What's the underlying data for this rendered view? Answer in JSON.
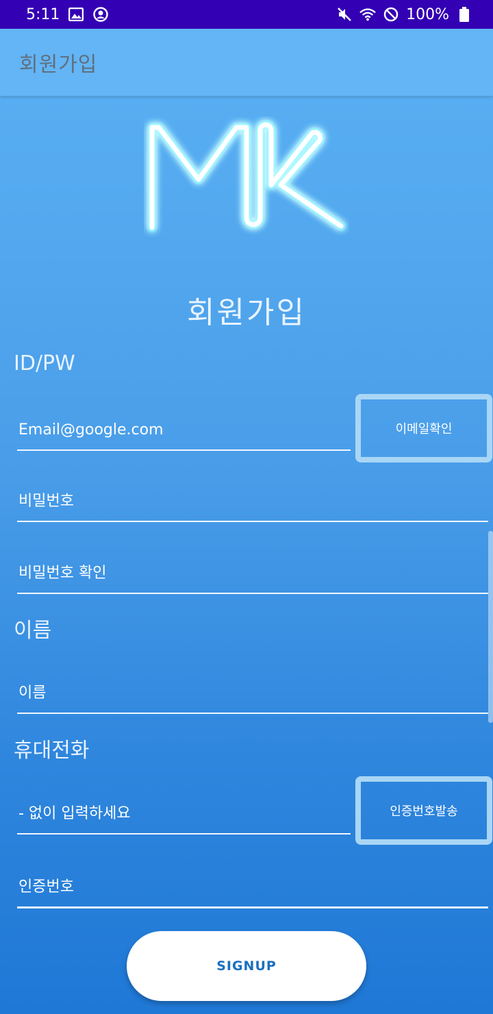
{
  "status_bar": {
    "time": "5:11",
    "battery": "100%",
    "icons": [
      "image-icon",
      "account-circle-icon",
      "mute-icon",
      "wifi-icon",
      "do-not-disturb-icon",
      "battery-icon"
    ]
  },
  "app_bar": {
    "title": "회원가입"
  },
  "logo": {
    "text": "MK"
  },
  "heading": "회원가입",
  "sections": {
    "idpw": "ID/PW",
    "name": "이름",
    "phone": "휴대전화"
  },
  "fields": {
    "email": {
      "value": "Email@google.com"
    },
    "password": {
      "placeholder": "비밀번호"
    },
    "password_confirm": {
      "placeholder": "비밀번호 확인"
    },
    "name": {
      "placeholder": "이름"
    },
    "phone": {
      "placeholder": "- 없이 입력하세요"
    },
    "auth_code": {
      "placeholder": "인증번호"
    }
  },
  "buttons": {
    "email_check": "이메일확인",
    "send_code": "인증번호발송",
    "signup": "SIGNUP"
  },
  "colors": {
    "status_bar": "#3300b3",
    "app_bar": "#63b5f5",
    "background_top": "#5cb2f4",
    "background_bottom": "#1f78d6",
    "button_border": "#a9d6f5"
  }
}
